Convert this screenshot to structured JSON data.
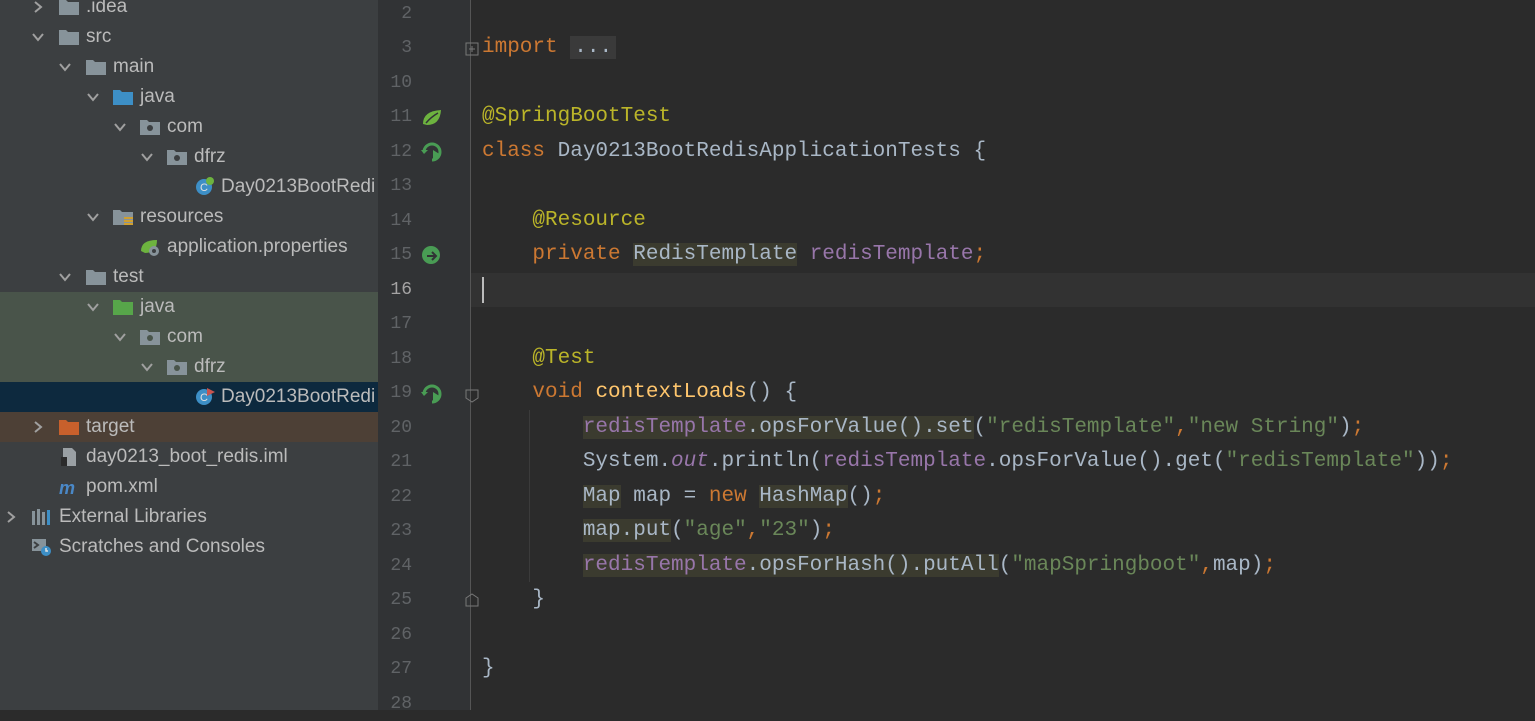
{
  "project_tree": {
    "items": [
      {
        "label": ".idea",
        "type": "folder",
        "expanded": false
      },
      {
        "label": "src",
        "type": "folder",
        "expanded": true
      },
      {
        "label": "main",
        "type": "folder",
        "expanded": true
      },
      {
        "label": "java",
        "type": "source-folder",
        "expanded": true
      },
      {
        "label": "com",
        "type": "package",
        "expanded": true
      },
      {
        "label": "dfrz",
        "type": "package",
        "expanded": true
      },
      {
        "label": "Day0213BootRedi",
        "type": "spring-boot-class"
      },
      {
        "label": "resources",
        "type": "resources-folder",
        "expanded": true
      },
      {
        "label": "application.properties",
        "type": "spring-properties"
      },
      {
        "label": "test",
        "type": "folder",
        "expanded": true
      },
      {
        "label": "java",
        "type": "test-source-folder",
        "expanded": true
      },
      {
        "label": "com",
        "type": "package",
        "expanded": true
      },
      {
        "label": "dfrz",
        "type": "package",
        "expanded": true
      },
      {
        "label": "Day0213BootRedi",
        "type": "test-class",
        "selected": true
      },
      {
        "label": "target",
        "type": "excluded-folder",
        "expanded": false
      },
      {
        "label": "day0213_boot_redis.iml",
        "type": "iml-file"
      },
      {
        "label": "pom.xml",
        "type": "maven-file"
      },
      {
        "label": "External Libraries",
        "type": "libraries",
        "expanded": false
      },
      {
        "label": "Scratches and Consoles",
        "type": "scratches"
      }
    ]
  },
  "editor": {
    "current_line": "16",
    "line_numbers": [
      "2",
      "3",
      "10",
      "11",
      "12",
      "13",
      "14",
      "15",
      "16",
      "17",
      "18",
      "19",
      "20",
      "21",
      "22",
      "23",
      "24",
      "25",
      "26",
      "27",
      "28"
    ],
    "code": {
      "l3": {
        "kw": "import",
        "fold": "..."
      },
      "l11": {
        "ann": "@SpringBootTest"
      },
      "l12": {
        "kw": "class",
        "rest": " Day0213BootRedisApplicationTests {"
      },
      "l14": {
        "ann": "@Resource"
      },
      "l15": {
        "kw": "private",
        "type": "RedisTemplate",
        "field": "redisTemplate",
        "semi": ";"
      },
      "l18": {
        "ann": "@Test"
      },
      "l19": {
        "kw": "void",
        "method": "contextLoads",
        "rest": "() {"
      },
      "l20": {
        "field": "redisTemplate",
        "a": ".opsForValue().set",
        "p1": "(",
        "s1": "\"redisTemplate\"",
        "comma": ",",
        "s2": "\"new String\"",
        "p2": ")",
        "semi": ";"
      },
      "l21": {
        "a": "System.",
        "out": "out",
        "b": ".println(",
        "field": "redisTemplate",
        "c": ".opsForValue().get(",
        "s1": "\"redisTemplate\"",
        "d": "))",
        "semi": ";"
      },
      "l22": {
        "a": "Map",
        "b": " map = ",
        "kw": "new",
        "sp": " ",
        "c": "HashMap",
        "d": "()",
        "semi": ";"
      },
      "l23": {
        "a": "map.put",
        "p1": "(",
        "s1": "\"age\"",
        "comma": ",",
        "s2": "\"23\"",
        "p2": ")",
        "semi": ";"
      },
      "l24": {
        "field": "redisTemplate",
        "a": ".opsForHash().putAll",
        "p1": "(",
        "s1": "\"mapSpringboot\"",
        "comma": ",",
        "b": "map)",
        "semi": ";"
      },
      "l25": {
        "brace": "}"
      },
      "l27": {
        "brace": "}"
      }
    }
  },
  "colors": {
    "keyword": "#cc7832",
    "annotation": "#bbb529",
    "field": "#9876aa",
    "string": "#6a8759",
    "method": "#ffc66d",
    "text": "#a9b7c6"
  }
}
